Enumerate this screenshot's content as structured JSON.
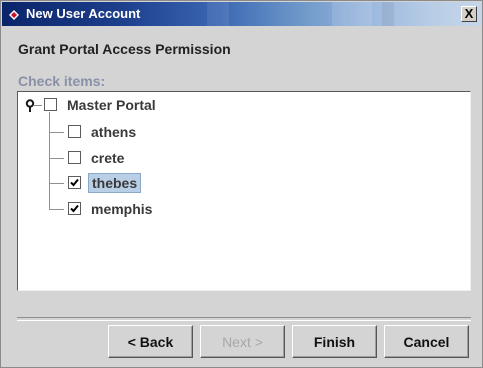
{
  "window": {
    "title": "New User Account",
    "close_label": "X"
  },
  "wizard": {
    "heading": "Grant Portal Access Permission",
    "check_items_label": "Check items:"
  },
  "tree": {
    "root": {
      "label": "Master Portal",
      "checked": false
    },
    "children": [
      {
        "label": "athens",
        "checked": false,
        "selected": false
      },
      {
        "label": "crete",
        "checked": false,
        "selected": false
      },
      {
        "label": "thebes",
        "checked": true,
        "selected": true
      },
      {
        "label": "memphis",
        "checked": true,
        "selected": false
      }
    ]
  },
  "buttons": {
    "back": {
      "label": "< Back",
      "enabled": true
    },
    "next": {
      "label": "Next >",
      "enabled": false
    },
    "finish": {
      "label": "Finish",
      "enabled": true
    },
    "cancel": {
      "label": "Cancel",
      "enabled": true
    }
  },
  "colors": {
    "titlebar_start": "#0a246a",
    "titlebar_end": "#c6d6ea",
    "selection": "#b8cfe5"
  }
}
